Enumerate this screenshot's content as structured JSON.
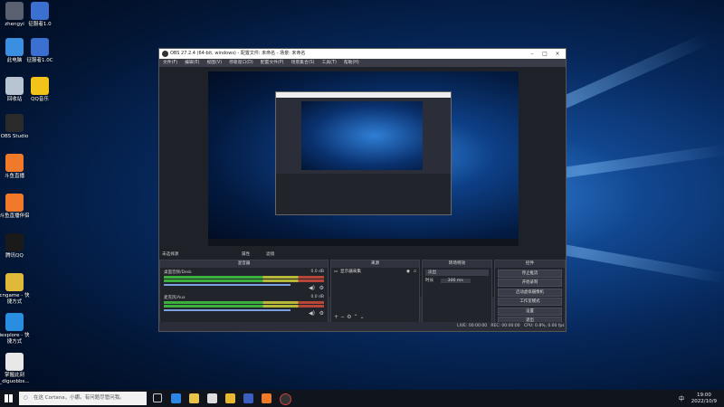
{
  "desktop": {
    "icons": [
      {
        "label": "zhengyi",
        "color": "#5a6070"
      },
      {
        "label": "征服者1.0",
        "color": "#3b6fd0"
      },
      {
        "label": "此电脑",
        "color": "#3c8ee0"
      },
      {
        "label": "征服者1.0C",
        "color": "#3b6fd0"
      },
      {
        "label": "回收站",
        "color": "#b9c4d2"
      },
      {
        "label": "QQ音乐",
        "color": "#f2c419"
      },
      {
        "label": "OBS Studio",
        "color": "#2a2a2a"
      },
      {
        "label": "斗鱼直播",
        "color": "#f07a2a"
      },
      {
        "label": "斗鱼直播伴侣",
        "color": "#f07a2a"
      },
      {
        "label": "腾讯QQ",
        "color": "#1a1a1a"
      },
      {
        "label": "cngame - 快\n捷方式",
        "color": "#e0b93a"
      },
      {
        "label": "iexplore - 快\n捷方式",
        "color": "#2a8ee0"
      },
      {
        "label": "掌握此刻\n_diguobbs...",
        "color": "#e8e8e8"
      }
    ]
  },
  "obs": {
    "title": "OBS 27.2.4 (64-bit, windows) - 配置文件: 未命名 - 场景: 未命名",
    "menu": [
      "文件(F)",
      "编辑(E)",
      "视图(V)",
      "停靠窗口(D)",
      "配置文件(P)",
      "场景集合(S)",
      "工具(T)",
      "帮助(H)"
    ],
    "no_source_selected": "未选择源",
    "properties_label": "属性",
    "filters_label": "滤镜",
    "mixer": {
      "title": "混音器",
      "tracks": [
        {
          "name": "桌面音频/Desk",
          "level": "0.0 dB"
        },
        {
          "name": "麦克风/Aux",
          "level": "0.0 dB"
        }
      ]
    },
    "sources": {
      "title": "来源",
      "items": [
        "显示器采集"
      ]
    },
    "transitions": {
      "title": "转场特效",
      "selected": "淡出",
      "duration_label": "时长",
      "duration_value": "300 ms"
    },
    "controls": {
      "title": "控件",
      "buttons": [
        "停止推流",
        "开始录制",
        "启动虚拟摄像机",
        "工作室模式",
        "设置",
        "退出"
      ]
    },
    "statusbar": {
      "live": "LIVE: 00:00:00",
      "rec": "REC: 00:00:00",
      "cpu": "CPU: 0.8%, 0.00 fps"
    }
  },
  "taskbar": {
    "search_placeholder": "在这 Cortana，小娜。有问题尽管问我。",
    "time": "19:00",
    "date": "2022/10/9",
    "input_method": "中"
  }
}
